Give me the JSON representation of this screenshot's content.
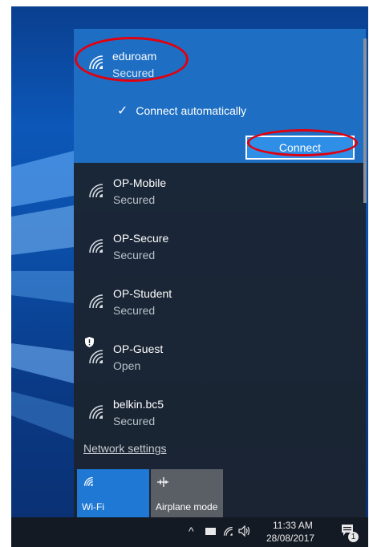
{
  "selected_network": {
    "name": "eduroam",
    "status": "Secured",
    "connect_auto_label": "Connect automatically",
    "connect_button": "Connect"
  },
  "networks": [
    {
      "name": "OP-Mobile",
      "status": "Secured"
    },
    {
      "name": "OP-Secure",
      "status": "Secured"
    },
    {
      "name": "OP-Student",
      "status": "Secured"
    },
    {
      "name": "OP-Guest",
      "status": "Open"
    },
    {
      "name": "belkin.bc5",
      "status": "Secured"
    }
  ],
  "network_settings_link": "Network settings",
  "quick_actions": [
    {
      "label": "Wi-Fi",
      "icon": "wifi-icon",
      "active": true
    },
    {
      "label": "Airplane mode",
      "icon": "airplane-icon",
      "active": false
    }
  ],
  "taskbar": {
    "time": "11:33 AM",
    "date": "28/08/2017",
    "notification_count": "1"
  },
  "colors": {
    "accent": "#1e6fc3",
    "button": "#2f8ee6",
    "annotation": "#e00010"
  }
}
